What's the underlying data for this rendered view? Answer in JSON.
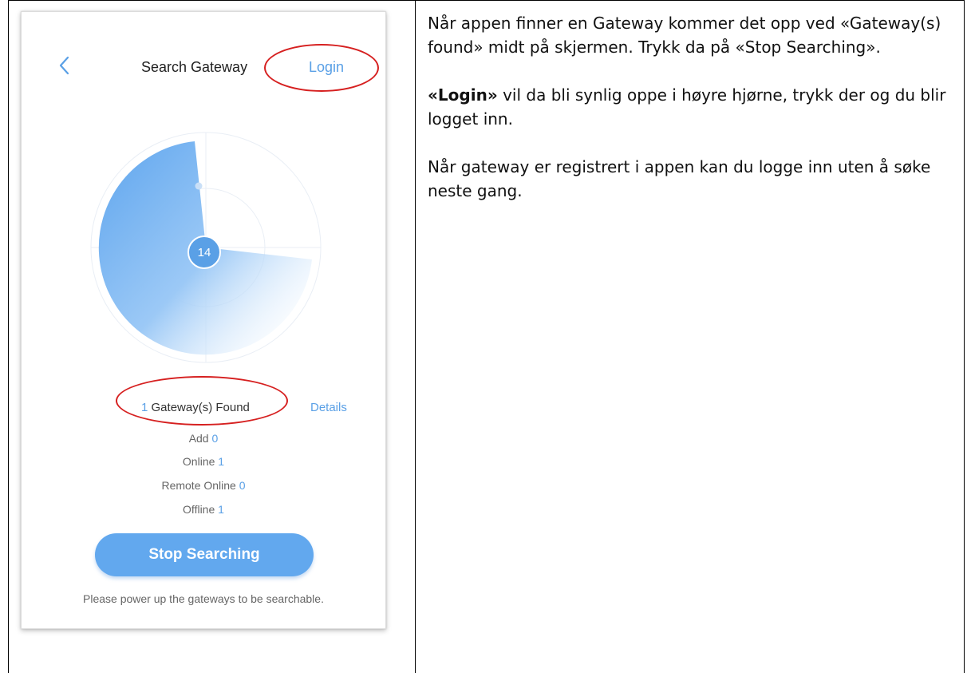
{
  "phone": {
    "title": "Search Gateway",
    "login_label": "Login",
    "radar_count": "14",
    "found_count": "1",
    "found_label": "Gateway(s) Found",
    "details_label": "Details",
    "stats": [
      {
        "label": "Add",
        "value": "0"
      },
      {
        "label": "Online",
        "value": "1"
      },
      {
        "label": "Remote Online",
        "value": "0"
      },
      {
        "label": "Offline",
        "value": "1"
      }
    ],
    "stop_button": "Stop Searching",
    "hint": "Please power up the gateways to be searchable."
  },
  "doc": {
    "p1": "Når appen finner en Gateway kommer det opp ved «Gateway(s) found» midt på skjermen. Trykk da på «Stop Searching».",
    "p2_bold": "«Login»",
    "p2_rest": " vil da bli synlig oppe i høyre hjørne, trykk der og du blir logget inn.",
    "p3": "Når gateway er registrert i appen kan du logge inn uten å søke neste gang."
  },
  "colors": {
    "accent": "#5aa0e6",
    "highlight": "#d62020",
    "button": "#62a8ee"
  },
  "icons": [
    "back-chevron-icon"
  ]
}
